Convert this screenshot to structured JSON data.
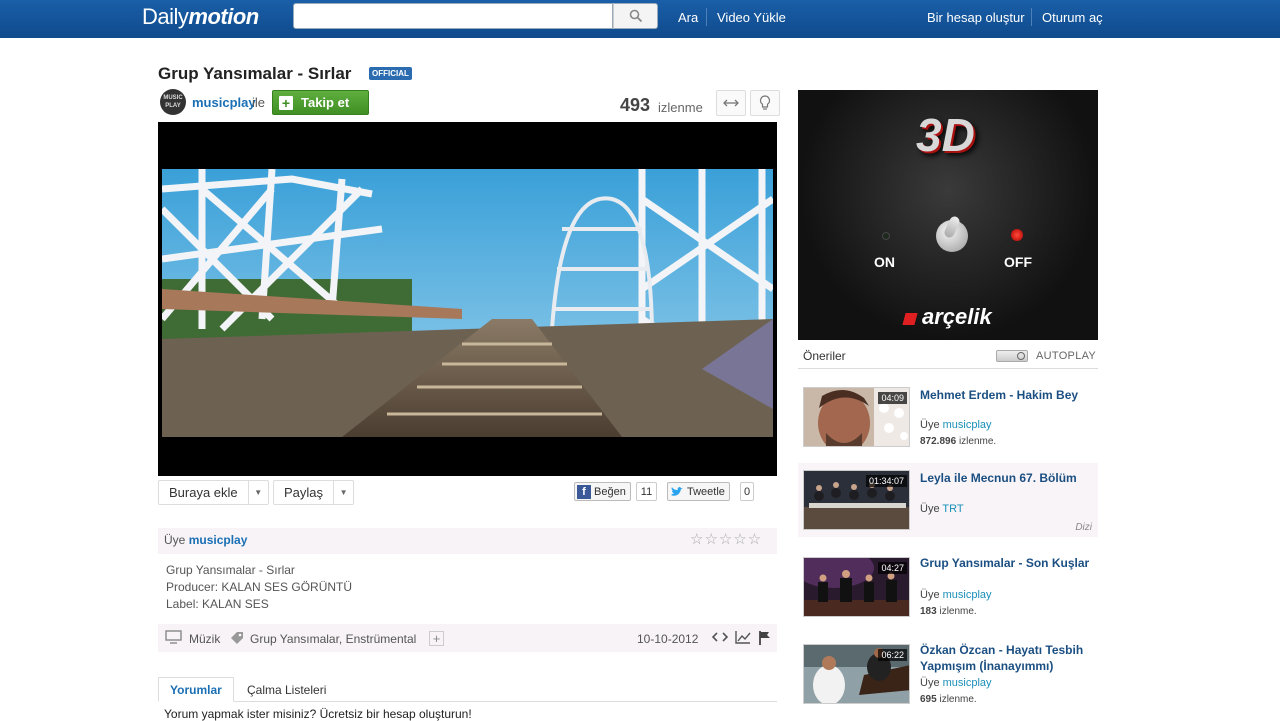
{
  "header": {
    "logo_text": "Daily",
    "logo_text_bold": "motion",
    "search_placeholder": "",
    "nav_search": "Ara",
    "nav_upload": "Video Yükle",
    "nav_signup": "Bir hesap oluştur",
    "nav_login": "Oturum aç"
  },
  "video": {
    "title": "Grup Yansımalar - Sırlar",
    "badge": "OFFICIAL",
    "avatar_text": "MUSIC PLAY",
    "channel": "musicplay",
    "channel_suffix": "ile",
    "follow_label": "Takip et",
    "views": "493",
    "views_label": "izlenme"
  },
  "actions": {
    "add_label": "Buraya ekle",
    "share_label": "Paylaş",
    "like_label": "Beğen",
    "like_count": "11",
    "tweet_label": "Tweetle",
    "tweet_count": "0"
  },
  "description": {
    "owner_prefix": "Üye",
    "owner": "musicplay",
    "rating_stars": "☆☆☆☆☆",
    "lines": [
      "Grup Yansımalar - Sırlar",
      "Producer: KALAN SES GÖRÜNTÜ",
      "Label: KALAN SES"
    ],
    "category": "Müzik",
    "tags": "Grup Yansımalar, Enstrümental",
    "date": "10-10-2012"
  },
  "tabs": {
    "comments": "Yorumlar",
    "playlists": "Çalma Listeleri",
    "comment_prompt": "Yorum yapmak ister misiniz? Ücretsiz bir hesap oluşturun!"
  },
  "ad": {
    "headline": "3D",
    "on_label": "ON",
    "off_label": "OFF",
    "brand": "arçelik"
  },
  "recommendations": {
    "title": "Öneriler",
    "autoplay_label": "AUTOPLAY",
    "items": [
      {
        "title": "Mehmet Erdem - Hakim Bey",
        "duration": "04:09",
        "owner_prefix": "Üye",
        "owner": "musicplay",
        "views": "872.896",
        "views_label": "izlenme.",
        "tag": ""
      },
      {
        "title": "Leyla ile Mecnun 67. Bölüm",
        "duration": "01:34:07",
        "owner_prefix": "Üye",
        "owner": "TRT",
        "views": "",
        "views_label": "",
        "tag": "Dizi"
      },
      {
        "title": "Grup Yansımalar - Son Kuşlar",
        "duration": "04:27",
        "owner_prefix": "Üye",
        "owner": "musicplay",
        "views": "183",
        "views_label": "izlenme.",
        "tag": ""
      },
      {
        "title": "Özkan Özcan - Hayatı Tesbih Yapmışım (İnanayımmı)",
        "duration": "06:22",
        "owner_prefix": "Üye",
        "owner": "musicplay",
        "views": "695",
        "views_label": "izlenme.",
        "tag": ""
      }
    ]
  },
  "colors": {
    "header_bg": "#1a5fa8",
    "link": "#1a6fb5",
    "follow_green": "#3f8f24",
    "rec_title": "#1b4f82"
  }
}
